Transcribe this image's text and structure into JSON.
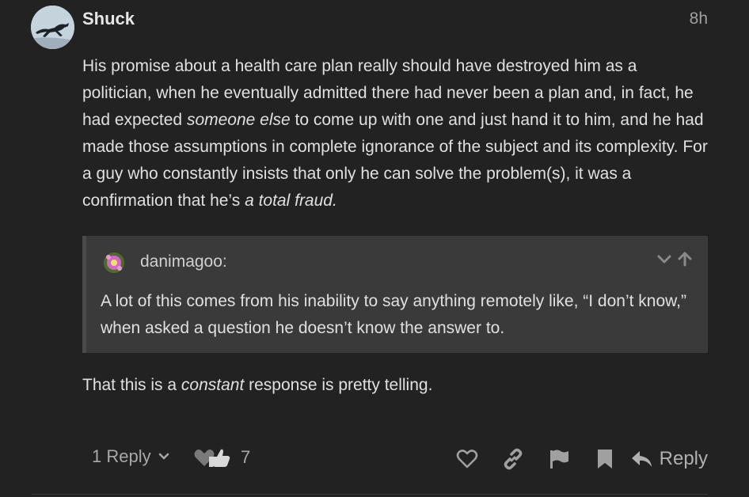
{
  "post": {
    "author": "Shuck",
    "age": "8h",
    "body": {
      "p1": "His promise about a health care plan really should have destroyed him as a politician, when he eventually admitted there had never been a plan and, in fact, he had expected ",
      "p1_em": "someone else",
      "p1_b": " to come up with one and just hand it to him, and he had made those assumptions in complete ignorance of the subject and its complexity. For a guy who constantly insists that only he can solve the problem(s), it was a confirmation that he’s ",
      "p1_em2": "a total fraud.",
      "p2_a": "That this is a ",
      "p2_em": "constant",
      "p2_b": " response is pretty telling."
    },
    "quote": {
      "author": "danimagoo:",
      "text": "A lot of this comes from his inability to say anything remotely like, “I don’t know,” when asked a question he doesn’t know the answer to."
    },
    "footer": {
      "replies_label": "1 Reply",
      "reaction_count": "7",
      "reply_label": "Reply"
    }
  },
  "icons": {
    "avatar": "running-dog-avatar",
    "quote_avatar": "flower-avatar",
    "expand": "chevron-down-icon",
    "jump": "arrow-up-icon",
    "like": "heart-icon",
    "link": "link-icon",
    "flag": "flag-icon",
    "bookmark": "bookmark-icon",
    "reply": "reply-arrow-icon"
  }
}
